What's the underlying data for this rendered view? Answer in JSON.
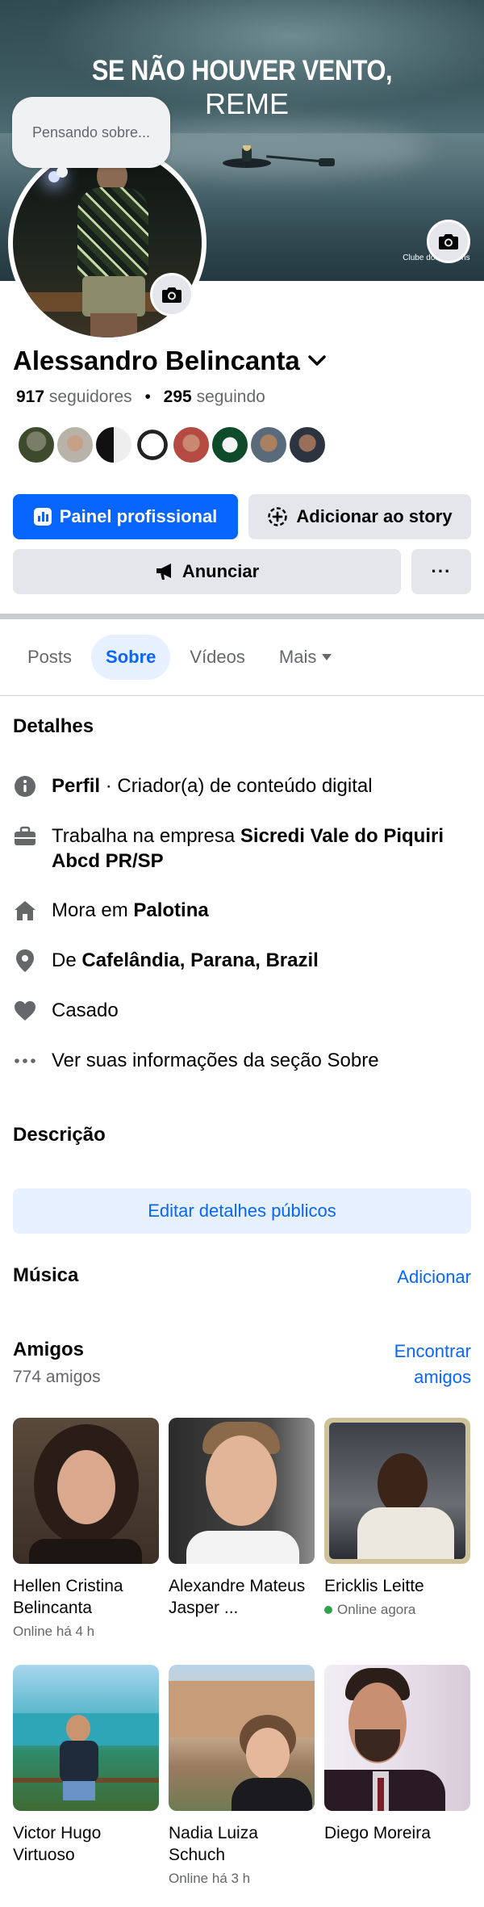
{
  "cover": {
    "line1": "SE NÃO HOUVER VENTO,",
    "line2": "REME",
    "brand": "Clube dos homens",
    "camera_icon": "camera-icon"
  },
  "thought_bubble": {
    "placeholder": "Pensando sobre..."
  },
  "profile": {
    "name": "Alessandro Belincanta",
    "followers_count": "917",
    "followers_label": "seguidores",
    "separator": "•",
    "following_count": "295",
    "following_label": "seguindo"
  },
  "actions": {
    "primary": "Painel profissional",
    "story": "Adicionar ao story",
    "ads": "Anunciar",
    "more": "···"
  },
  "tabs": [
    {
      "label": "Posts"
    },
    {
      "label": "Sobre"
    },
    {
      "label": "Vídeos"
    },
    {
      "label": "Mais"
    }
  ],
  "details": {
    "title": "Detalhes",
    "profile_label": "Perfil",
    "profile_value": " · Criador(a) de conteúdo digital",
    "work_prefix": "Trabalha na empresa ",
    "work_value": "Sicredi Vale do Piquiri Abcd PR/SP",
    "lives_prefix": "Mora em ",
    "lives_value": "Palotina",
    "from_prefix": "De ",
    "from_value": "Cafelândia, Parana, Brazil",
    "relationship": "Casado",
    "see_more": "Ver suas informações da seção Sobre"
  },
  "description": {
    "title": "Descrição",
    "edit_button": "Editar detalhes públicos"
  },
  "music": {
    "title": "Música",
    "add": "Adicionar"
  },
  "friends": {
    "title": "Amigos",
    "count": "774 amigos",
    "find_line1": "Encontrar",
    "find_line2": "amigos",
    "items": [
      {
        "name": "Hellen Cristina Belincanta",
        "status": "Online há 4 h"
      },
      {
        "name": "Alexandre Mateus Jasper ...",
        "status": ""
      },
      {
        "name": "Ericklis Leitte",
        "status": "Online agora"
      },
      {
        "name": "Victor Hugo Virtuoso",
        "status": ""
      },
      {
        "name": "Nadia Luiza Schuch",
        "status": "Online há 3 h"
      },
      {
        "name": "Diego Moreira",
        "status": ""
      }
    ]
  },
  "colors": {
    "accent": "#0866ff",
    "secondary_bg": "#e4e6eb",
    "muted_text": "#65676b",
    "online": "#31a24c"
  }
}
